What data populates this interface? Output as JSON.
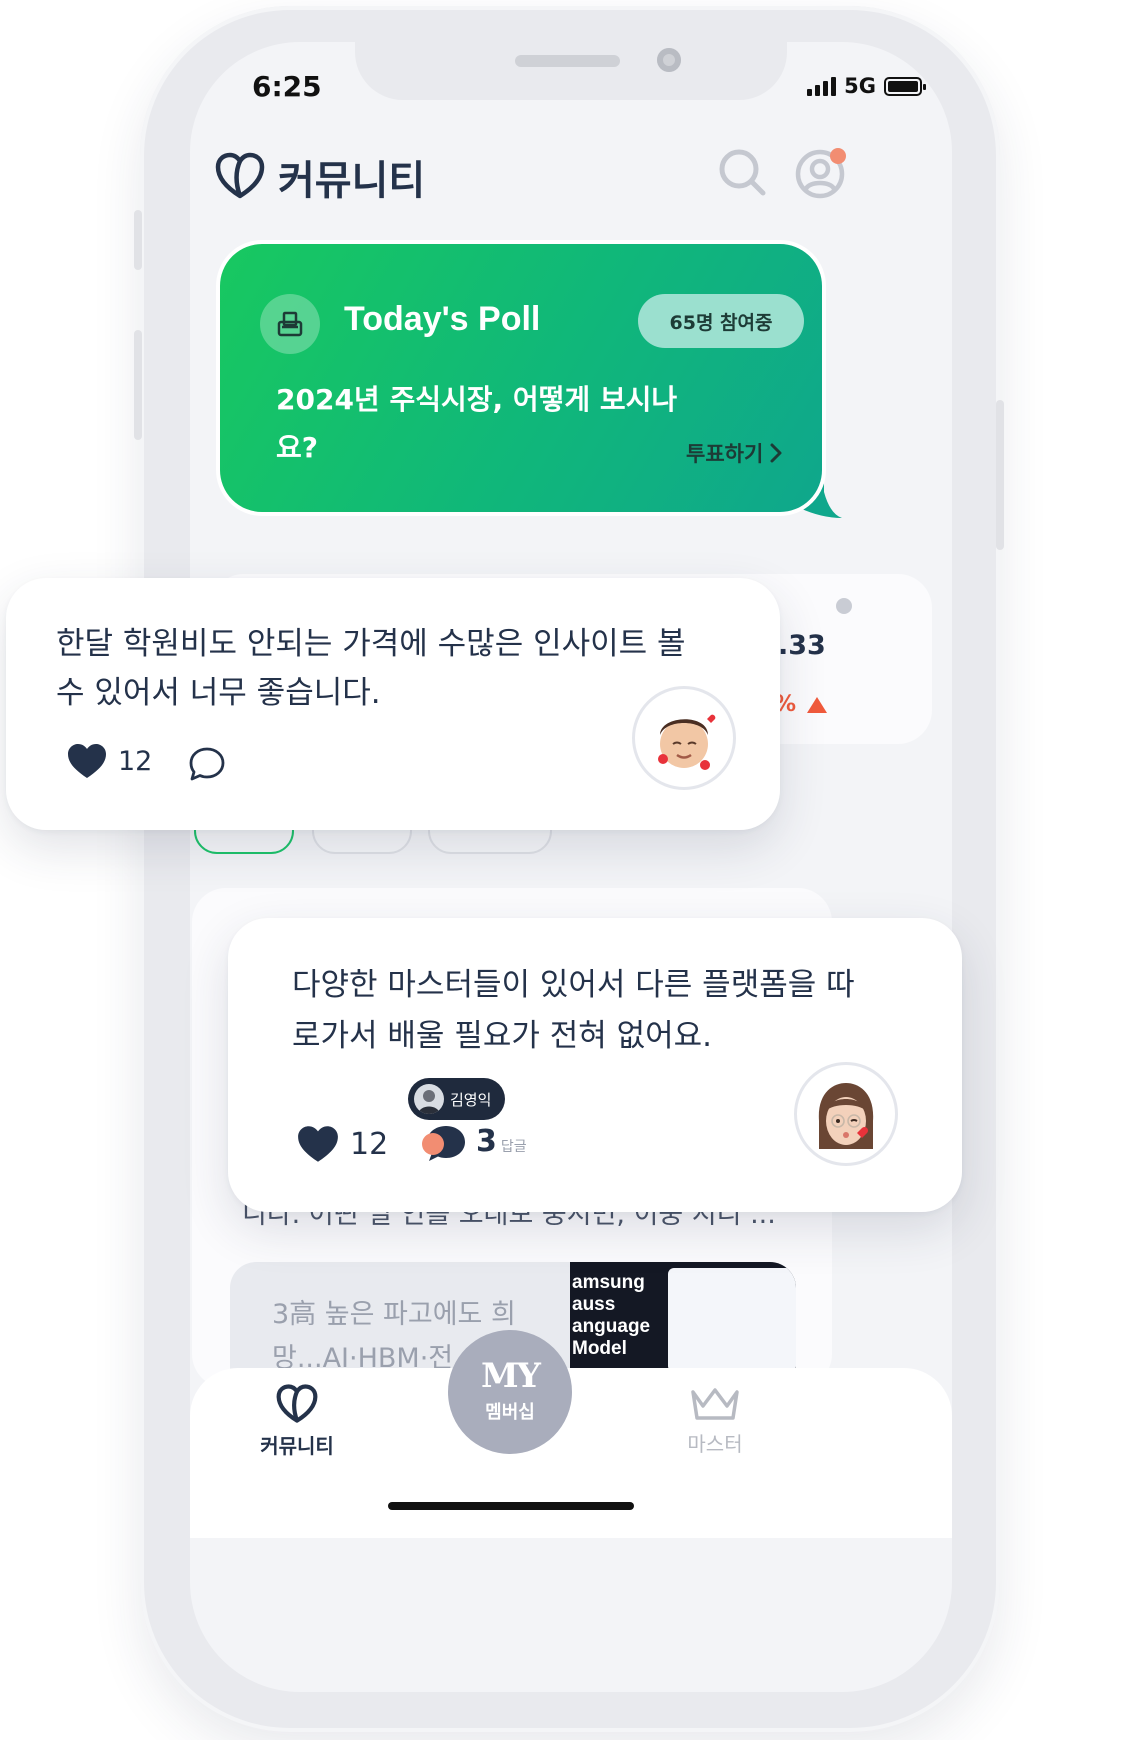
{
  "status_bar": {
    "time": "6:25",
    "network": "5G"
  },
  "header": {
    "title": "커뮤니티"
  },
  "poll": {
    "title": "Today's Poll",
    "participants": "65명 참여중",
    "question": "2024년 주식시장, 어떻게 보시나요?",
    "vote_label": "투표하기"
  },
  "ticker": {
    "value_suffix": ".33",
    "change_suffix": "%"
  },
  "feed": {
    "snippet": "니다. 어떤 일 인를 오래보 중시면, 이중 시리 ...",
    "article_title_line1": "3高 높은 파고에도 희",
    "article_title_line2": "망...AI·HBM·전",
    "thumbnail_text": "amsung\nauss\nanguage\nModel"
  },
  "reviews": [
    {
      "text": "한달 학원비도 안되는 가격에 수많은 인사이트 볼 수 있어서 너무 좋습니다.",
      "likes": "12"
    },
    {
      "text": "다양한 마스터들이 있어서 다른 플랫폼을 따로가서 배울 필요가 전혀 없어요.",
      "likes": "12",
      "reply_author": "김영익",
      "reply_count": "3",
      "reply_label": "답글"
    }
  ],
  "tabbar": {
    "community": "커뮤니티",
    "my_badge": "MY",
    "membership": "멤버십",
    "master": "마스터"
  },
  "colors": {
    "accent_green": "#18c860",
    "navy": "#24324a",
    "notification": "#f28d72",
    "up_red": "#f05a3c"
  }
}
